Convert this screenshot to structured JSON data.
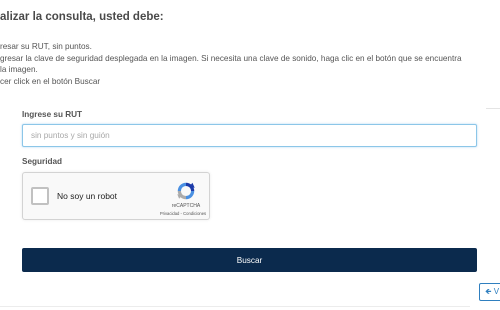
{
  "heading": "alizar la consulta, usted debe:",
  "instructions": [
    "resar su RUT, sin puntos.",
    "gresar la clave de seguridad desplegada en la imagen. Si necesita una clave de sonido, haga clic en el botón que se encuentra",
    "la imagen.",
    "cer click en el botón Buscar"
  ],
  "form": {
    "rut_label": "Ingrese su RUT",
    "rut_placeholder": "sin puntos y sin guión",
    "rut_value": "",
    "security_label": "Seguridad"
  },
  "captcha": {
    "checkbox_label": "No soy un robot",
    "brand": "reCAPTCHA",
    "links": "Privacidad - Condiciones",
    "logo_icon": "recaptcha-logo-icon"
  },
  "buttons": {
    "search_label": "Buscar",
    "back_icon": "arrow-left-icon",
    "back_label": "V"
  },
  "colors": {
    "primary": "#0b2a4d",
    "input_focus_border": "#8cc6e8",
    "link_blue": "#2f7fbf"
  }
}
